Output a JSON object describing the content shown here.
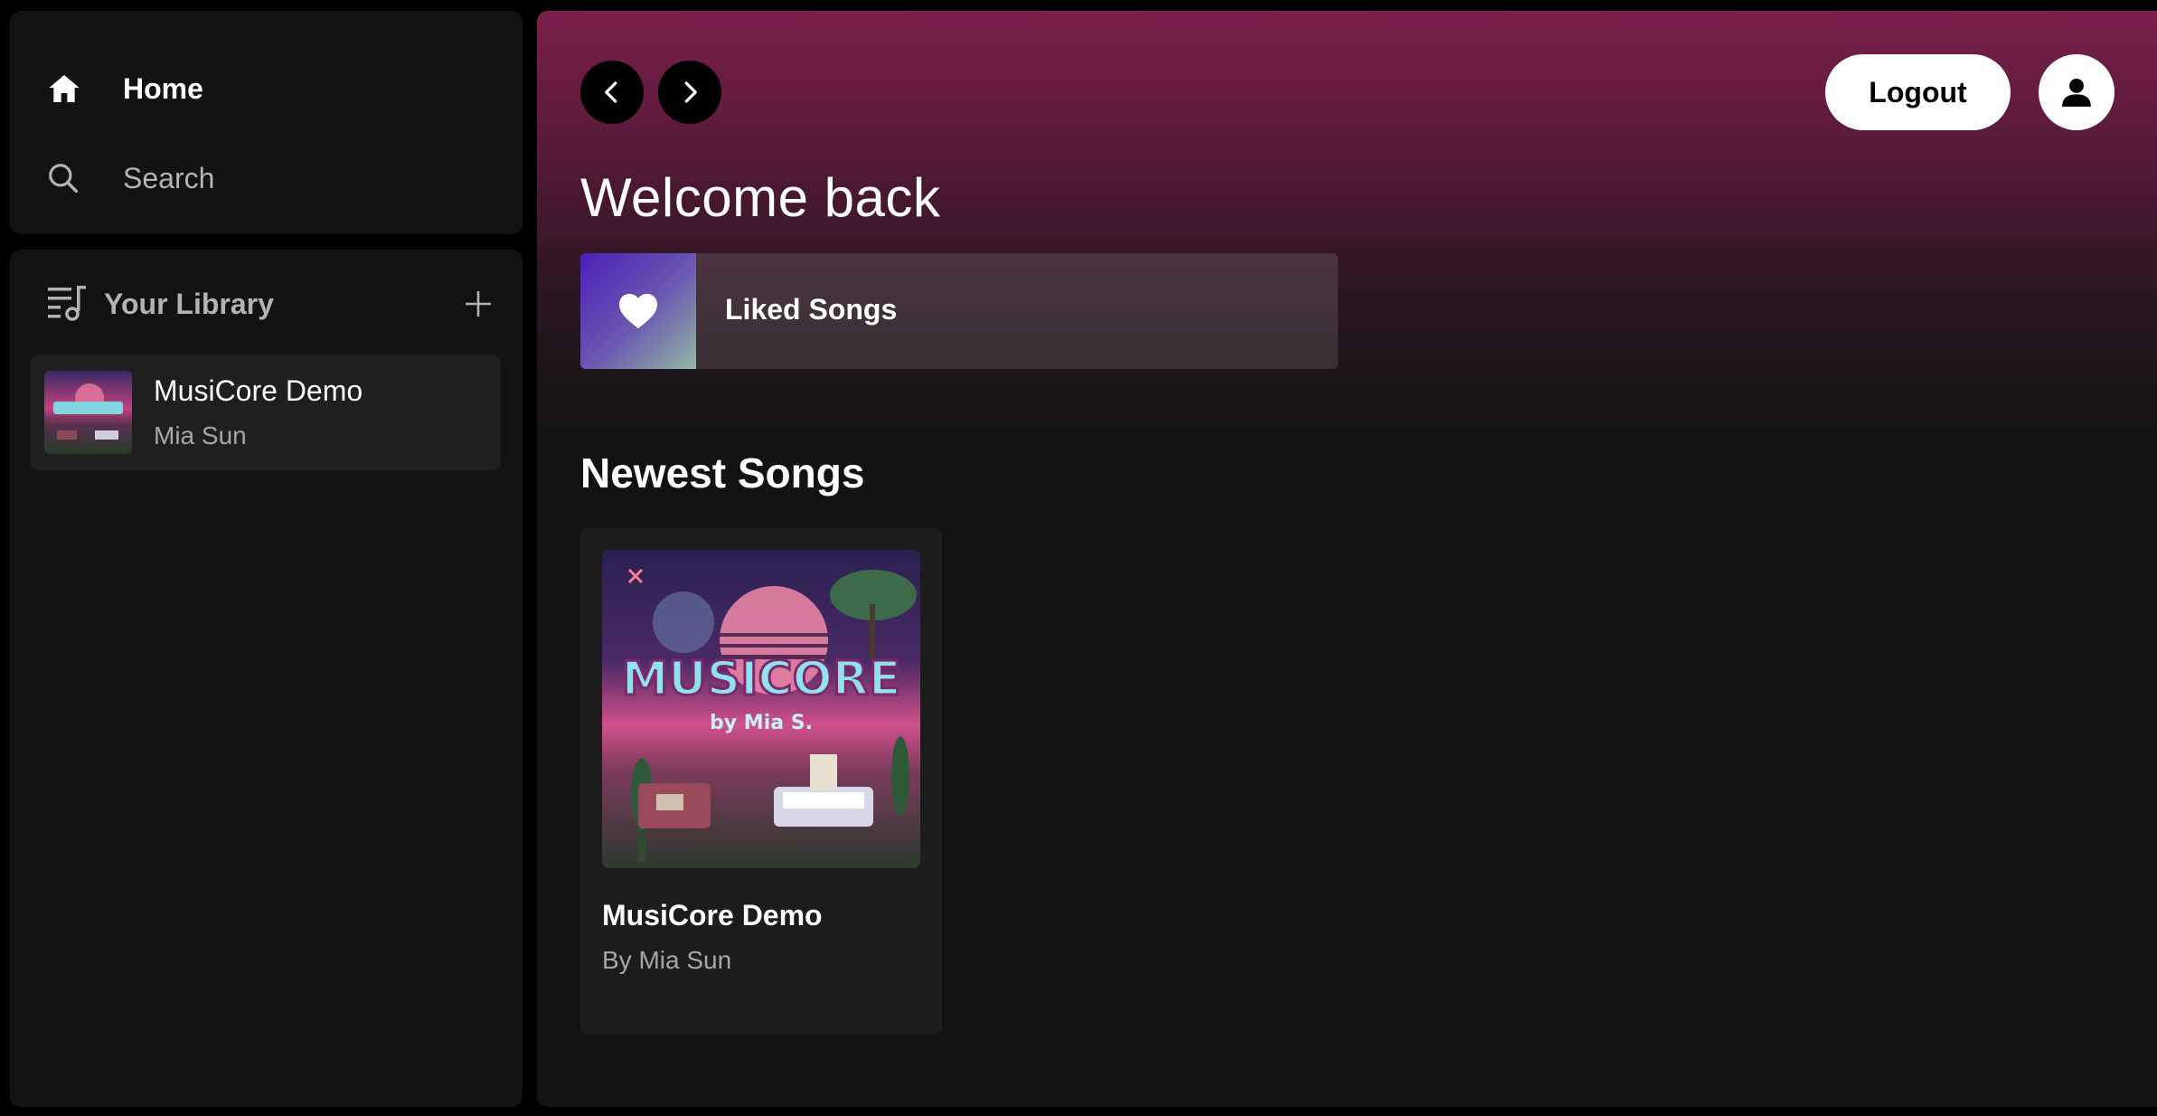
{
  "sidebar": {
    "nav": {
      "home_label": "Home",
      "search_label": "Search"
    },
    "library": {
      "title": "Your Library",
      "items": [
        {
          "title": "MusiCore Demo",
          "artist": "Mia Sun",
          "cover_text": "MUSICORE"
        }
      ]
    }
  },
  "header": {
    "logout_label": "Logout"
  },
  "main": {
    "welcome": "Welcome back",
    "liked_songs_label": "Liked Songs",
    "newest_title": "Newest Songs",
    "songs": [
      {
        "title": "MusiCore Demo",
        "artist": "By Mia Sun",
        "cover_title": "MUSICORE",
        "cover_subtitle": "by Mia S."
      }
    ]
  },
  "colors": {
    "accent_gradient_top": "#7a1f4b",
    "background": "#121212",
    "panel": "#121212",
    "muted_text": "#b3b3b3"
  },
  "icons": [
    "home-icon",
    "search-icon",
    "library-icon",
    "plus-icon",
    "chevron-left-icon",
    "chevron-right-icon",
    "user-icon",
    "heart-icon"
  ]
}
